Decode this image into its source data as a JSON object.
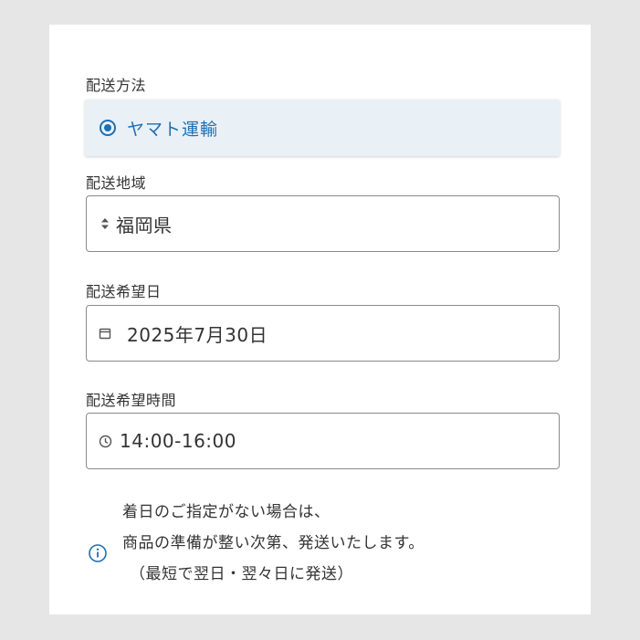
{
  "shipping_method": {
    "label": "配送方法",
    "selected": "ヤマト運輸"
  },
  "region": {
    "label": "配送地域",
    "value": "福岡県"
  },
  "date": {
    "label": "配送希望日",
    "value": "2025年7月30日"
  },
  "time": {
    "label": "配送希望時間",
    "value": "14:00-16:00"
  },
  "note": {
    "line1": "着日のご指定がない場合は、",
    "line2": "商品の準備が整い次第、発送いたします。",
    "line3": "（最短で翌日・翌々日に発送）"
  },
  "colors": {
    "accent": "#1f6fb2",
    "selected_bg": "#e9f1f7"
  }
}
